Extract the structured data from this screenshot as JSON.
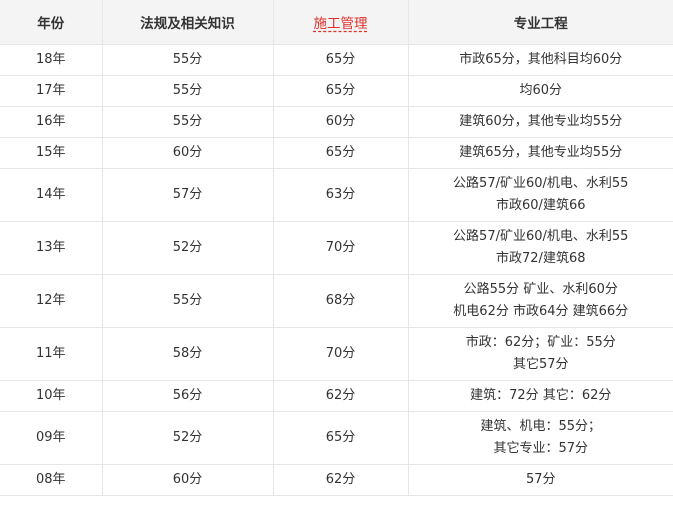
{
  "headers": [
    "年份",
    "法规及相关知识",
    "施工管理",
    "专业工程"
  ],
  "accent_color": "#e0302a",
  "rows": [
    {
      "year": "18年",
      "law": "55分",
      "mgmt": "65分",
      "pro": [
        "市政65分，其他科目均60分"
      ]
    },
    {
      "year": "17年",
      "law": "55分",
      "mgmt": "65分",
      "pro": [
        "均60分"
      ]
    },
    {
      "year": "16年",
      "law": "55分",
      "mgmt": "60分",
      "pro": [
        "建筑60分，其他专业均55分"
      ]
    },
    {
      "year": "15年",
      "law": "60分",
      "mgmt": "65分",
      "pro": [
        "建筑65分，其他专业均55分"
      ]
    },
    {
      "year": "14年",
      "law": "57分",
      "mgmt": "63分",
      "pro": [
        "公路57/矿业60/机电、水利55",
        "市政60/建筑66"
      ]
    },
    {
      "year": "13年",
      "law": "52分",
      "mgmt": "70分",
      "pro": [
        "公路57/矿业60/机电、水利55",
        "市政72/建筑68"
      ]
    },
    {
      "year": "12年",
      "law": "55分",
      "mgmt": "68分",
      "pro": [
        "公路55分 矿业、水利60分",
        "机电62分 市政64分 建筑66分"
      ]
    },
    {
      "year": "11年",
      "law": "58分",
      "mgmt": "70分",
      "pro": [
        "市政：62分；矿业：55分",
        "其它57分"
      ]
    },
    {
      "year": "10年",
      "law": "56分",
      "mgmt": "62分",
      "pro": [
        "建筑：72分 其它：62分"
      ]
    },
    {
      "year": "09年",
      "law": "52分",
      "mgmt": "65分",
      "pro": [
        "建筑、机电：55分；",
        "其它专业：57分"
      ]
    },
    {
      "year": "08年",
      "law": "60分",
      "mgmt": "62分",
      "pro": [
        "57分"
      ]
    }
  ]
}
